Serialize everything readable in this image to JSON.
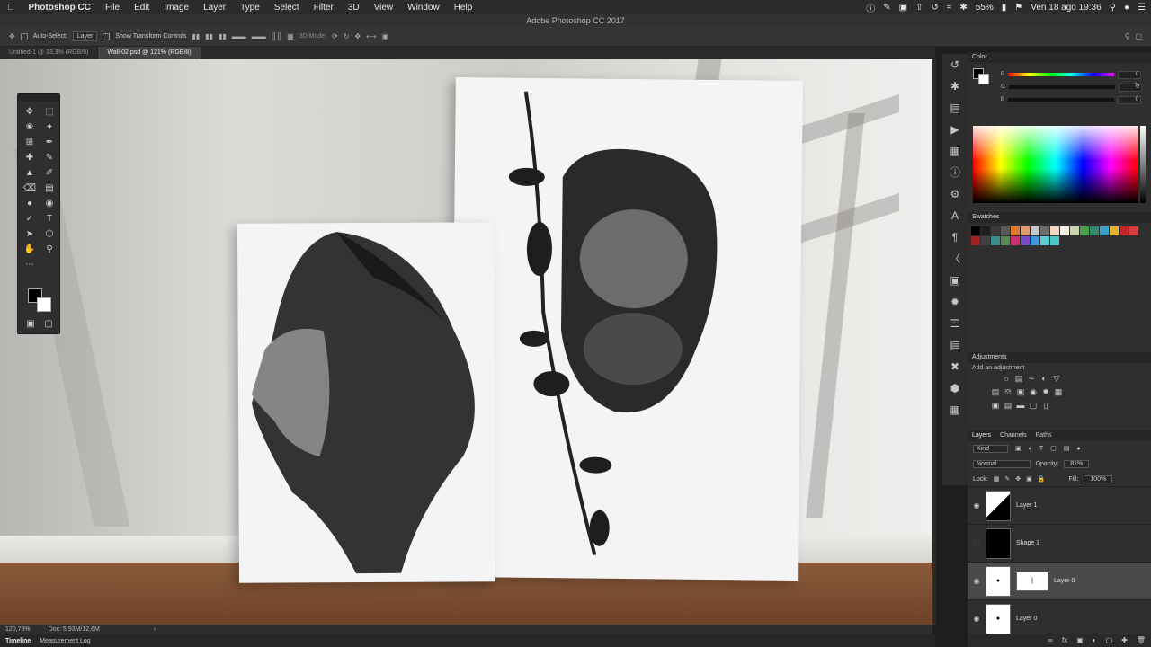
{
  "menubar": {
    "apple_icon": "apple-icon",
    "app_name": "Photoshop CC",
    "items": [
      "File",
      "Edit",
      "Image",
      "Layer",
      "Type",
      "Select",
      "Filter",
      "3D",
      "View",
      "Window",
      "Help"
    ],
    "battery": "55%",
    "datetime": "Ven 18 ago 19:36"
  },
  "window": {
    "title": "Adobe Photoshop CC 2017"
  },
  "options": {
    "auto_select": "Auto-Select:",
    "auto_select_value": "Layer",
    "transform": "Show Transform Controls",
    "mode3d": "3D Mode:"
  },
  "tabs": [
    {
      "label": "Untitled-1 @ 33,3% (RGB/8)"
    },
    {
      "label": "Wall-02.psd @ 121% (RGB/8)"
    }
  ],
  "status": {
    "zoom": "120,78%",
    "doc": "Doc: 5,93M/12,6M"
  },
  "bottom_tabs": [
    "Timeline",
    "Measurement Log"
  ],
  "color_panel": {
    "title": "Color",
    "r_label": "R",
    "g_label": "G",
    "b_label": "B",
    "r": "0",
    "g": "0",
    "b": "0",
    "pct": "%"
  },
  "swatches_panel": {
    "title": "Swatches",
    "colors": [
      "#000000",
      "#1e1e1e",
      "#3a3a3a",
      "#595959",
      "#e07a2f",
      "#e09a70",
      "#c8c8c8",
      "#6e6e6e",
      "#f2d7c6",
      "#f6f0e6",
      "#c8d6b0",
      "#4aa04a",
      "#2f8a6e",
      "#3aa0c8",
      "#e6b030",
      "#c02828",
      "#d83c3c",
      "#a02020",
      "#404040",
      "#3c8c8c",
      "#5a8a5a",
      "#c83070",
      "#7a4ac8",
      "#3a9ae0",
      "#5ad0d0",
      "#48c8c8"
    ]
  },
  "adjustments_panel": {
    "title": "Adjustments",
    "subtitle": "Add an adjustment"
  },
  "layers_panel": {
    "tabs": [
      "Layers",
      "Channels",
      "Paths"
    ],
    "kind": "Kind",
    "blend": "Normal",
    "opacity_label": "Opacity:",
    "opacity": "81%",
    "lock_label": "Lock:",
    "fill_label": "Fill:",
    "fill": "100%",
    "layers": [
      {
        "name": "Layer 1"
      },
      {
        "name": "Shape 1"
      },
      {
        "name": "Layer 0"
      },
      {
        "name": "Layer 0"
      }
    ]
  }
}
